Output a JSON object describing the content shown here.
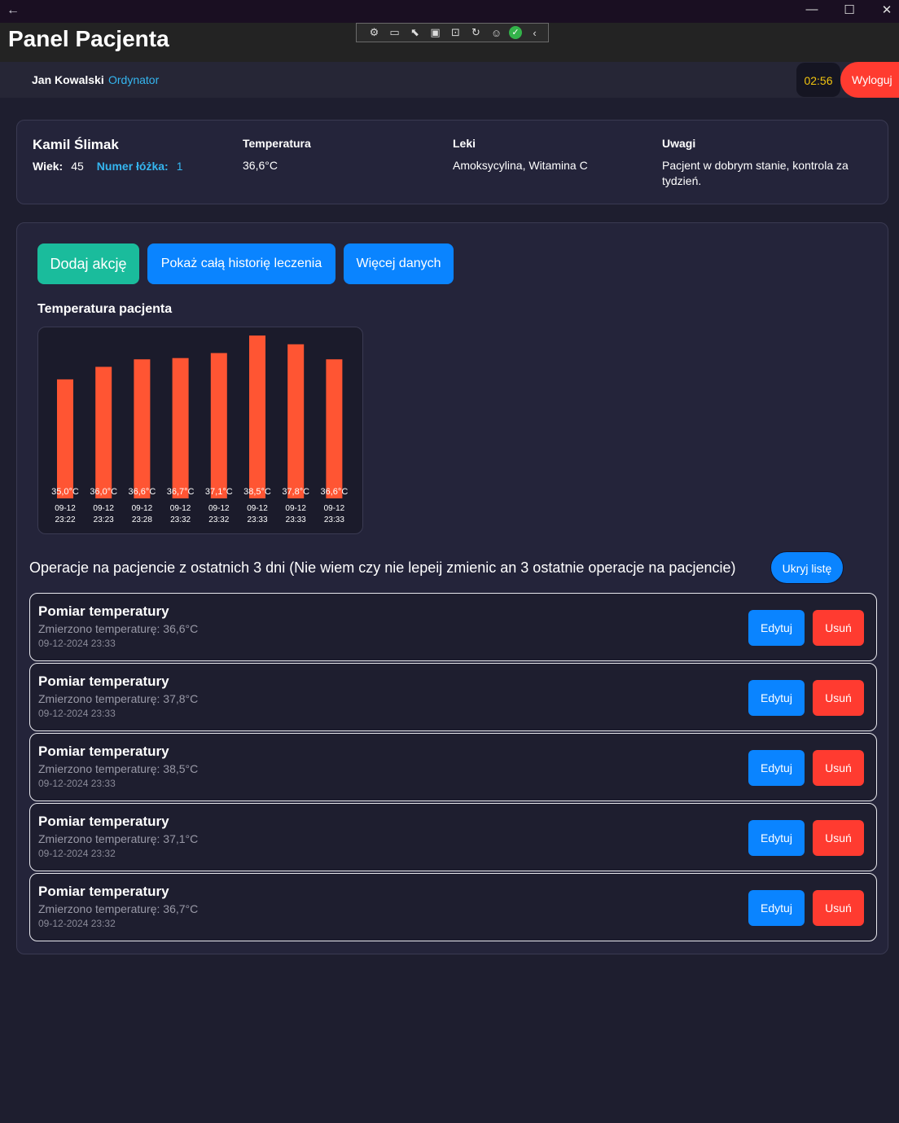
{
  "window": {
    "back_icon": "arrow-left-icon",
    "controls": [
      "minimize-icon",
      "maximize-icon",
      "close-icon"
    ]
  },
  "header": {
    "title": "Panel Pacjenta"
  },
  "devtools": {
    "icons": [
      "app-settings-icon",
      "video-icon",
      "select-element-icon",
      "layout-bounds-icon",
      "display-layout-icon",
      "hot-reload-icon",
      "accessibility-icon",
      "check-icon",
      "chevron-left-icon"
    ]
  },
  "user": {
    "name": "Jan Kowalski",
    "role": "Ordynator",
    "timer": "02:56",
    "logout_label": "Wyloguj"
  },
  "patient": {
    "name": "Kamil Ślimak",
    "age_label": "Wiek:",
    "age": "45",
    "bed_label": "Numer łóżka:",
    "bed": "1",
    "temperature_label": "Temperatura",
    "temperature": "36,6°C",
    "meds_label": "Leki",
    "meds": "Amoksycylina, Witamina C",
    "notes_label": "Uwagi",
    "notes": "Pacjent w dobrym stanie, kontrola za tydzień."
  },
  "actions": {
    "add_label": "Dodaj akcję",
    "history_label": "Pokaż całą historię leczenia",
    "more_label": "Więcej danych"
  },
  "chart_data": {
    "type": "bar",
    "title": "Temperatura pacjenta",
    "categories": [
      [
        "09-12",
        "23:22"
      ],
      [
        "09-12",
        "23:23"
      ],
      [
        "09-12",
        "23:28"
      ],
      [
        "09-12",
        "23:32"
      ],
      [
        "09-12",
        "23:32"
      ],
      [
        "09-12",
        "23:33"
      ],
      [
        "09-12",
        "23:33"
      ],
      [
        "09-12",
        "23:33"
      ]
    ],
    "values": [
      35.0,
      36.0,
      36.6,
      36.7,
      37.1,
      38.5,
      37.8,
      36.6
    ],
    "value_labels": [
      "35,0°C",
      "36,0°C",
      "36,6°C",
      "36,7°C",
      "37,1°C",
      "38,5°C",
      "37,8°C",
      "36,6°C"
    ],
    "bar_color": "#ff5533",
    "grid": false
  },
  "operations": {
    "title": "Operacje na pacjencie z ostatnich 3 dni (Nie wiem czy nie lepeij zmienic an 3 ostatnie operacje na pacjencie)",
    "hide_label": "Ukryj listę",
    "edit_label": "Edytuj",
    "delete_label": "Usuń",
    "items": [
      {
        "title": "Pomiar temperatury",
        "desc": "Zmierzono temperaturę: 36,6°C",
        "date": "09-12-2024 23:33"
      },
      {
        "title": "Pomiar temperatury",
        "desc": "Zmierzono temperaturę: 37,8°C",
        "date": "09-12-2024 23:33"
      },
      {
        "title": "Pomiar temperatury",
        "desc": "Zmierzono temperaturę: 38,5°C",
        "date": "09-12-2024 23:33"
      },
      {
        "title": "Pomiar temperatury",
        "desc": "Zmierzono temperaturę: 37,1°C",
        "date": "09-12-2024 23:32"
      },
      {
        "title": "Pomiar temperatury",
        "desc": "Zmierzono temperaturę: 36,7°C",
        "date": "09-12-2024 23:32"
      }
    ]
  },
  "colors": {
    "background": "#1e1e2f",
    "primary": "#0a84ff",
    "danger": "#ff3b30",
    "success": "#1abc9c",
    "accent": "#35b6f0",
    "timer": "#f1c40f"
  }
}
